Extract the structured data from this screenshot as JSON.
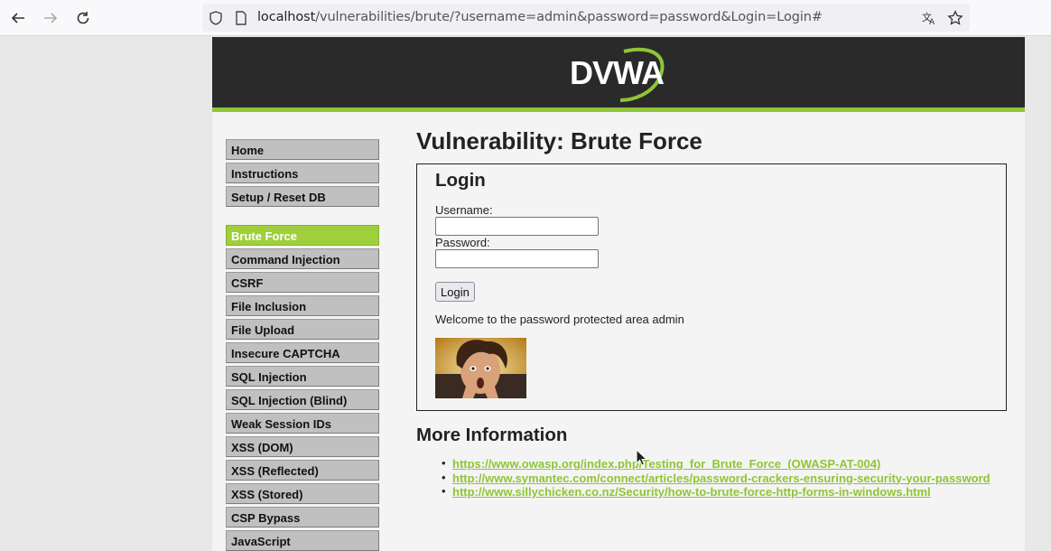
{
  "browser": {
    "url_host": "localhost",
    "url_rest": "/vulnerabilities/brute/?username=admin&password=password&Login=Login#"
  },
  "header": {
    "logo_text": "DVWA"
  },
  "sidebar": {
    "group1": [
      "Home",
      "Instructions",
      "Setup / Reset DB"
    ],
    "group2": [
      "Brute Force",
      "Command Injection",
      "CSRF",
      "File Inclusion",
      "File Upload",
      "Insecure CAPTCHA",
      "SQL Injection",
      "SQL Injection (Blind)",
      "Weak Session IDs",
      "XSS (DOM)",
      "XSS (Reflected)",
      "XSS (Stored)",
      "CSP Bypass",
      "JavaScript"
    ],
    "active": "Brute Force"
  },
  "main": {
    "title": "Vulnerability: Brute Force",
    "login_heading": "Login",
    "username_label": "Username:",
    "username_value": "",
    "password_label": "Password:",
    "password_value": "",
    "login_button": "Login",
    "welcome": "Welcome to the password protected area admin",
    "more_heading": "More Information",
    "links": [
      "https://www.owasp.org/index.php/Testing_for_Brute_Force_(OWASP-AT-004)",
      "http://www.symantec.com/connect/articles/password-crackers-ensuring-security-your-password",
      "http://www.sillychicken.co.nz/Security/how-to-brute-force-http-forms-in-windows.html"
    ]
  },
  "colors": {
    "accent": "#8fc536",
    "header_bg": "#2a2a2a",
    "menu_active": "#9fcf3a"
  }
}
